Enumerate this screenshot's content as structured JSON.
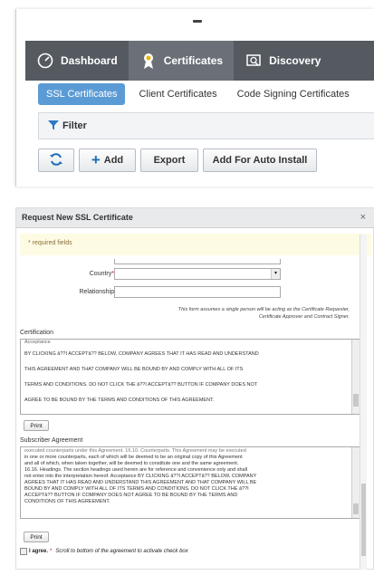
{
  "nav": {
    "tabs": [
      {
        "label": "Dashboard",
        "icon": "gauge-icon"
      },
      {
        "label": "Certificates",
        "icon": "ribbon-icon"
      },
      {
        "label": "Discovery",
        "icon": "scan-icon"
      }
    ]
  },
  "subtabs": [
    "SSL Certificates",
    "Client Certificates",
    "Code Signing Certificates"
  ],
  "filter": {
    "label": "Filter"
  },
  "actions": {
    "refresh_icon": "refresh-icon",
    "add": "Add",
    "export": "Export",
    "add_auto": "Add For Auto Install"
  },
  "dialog": {
    "title": "Request New SSL Certificate",
    "required_note": "* required fields",
    "country_label": "Country",
    "relationship_label": "Relationship",
    "form_note_1": "This form assumes a single person will be acting as the Certificate Requester,",
    "form_note_2": "Certificate Approver and Contract Signer.",
    "certification_label": "Certification",
    "cert_text_0": "Acceptance",
    "cert_text_1": "BY CLICKING â??I ACCEPTâ?? BELOW, COMPANY AGREES THAT IT HAS READ AND UNDERSTAND",
    "cert_text_2": "THIS AGREEMENT AND THAT COMPANY WILL BE BOUND BY AND COMPLY WITH ALL OF ITS",
    "cert_text_3": "TERMS AND CONDITIONS. DO NOT CLICK THE â??I ACCEPTâ?? BUTTON IF COMPANY DOES NOT",
    "cert_text_4": "AGREE TO BE BOUND BY THE TERMS AND CONDITIONS OF THIS AGREEMENT.",
    "print_label": "Print",
    "subscriber_label": "Subscriber Agreement",
    "sub_text": [
      "executed counterparts under this Agreement. 16.10. Counterparts. This Agreement may be executed",
      "in one or more counterparts, each of which will be deemed to be an original copy of this Agreement",
      "and all of which, when taken together, will be deemed to constitute one and the same agreement.",
      "16.16. Headings. The section headings used herein are for reference and convenience only and shall",
      "not enter into the interpretation hereof. Acceptance BY CLICKING â??I ACCEPTâ?? BELOW, COMPANY",
      "AGREES THAT IT HAS READ AND UNDERSTAND THIS AGREEMENT AND THAT COMPANY WILL BE",
      "BOUND BY AND COMPLY WITH ALL OF ITS TERMS AND CONDITIONS. DO NOT CLICK THE â??I",
      "ACCEPTâ?? BUTTON IF COMPANY DOES NOT AGREE TO BE BOUND BY THE TERMS AND",
      "CONDITIONS OF THIS AGREEMENT."
    ],
    "agree_label": "I agree.",
    "agree_hint": "Scroll to bottom of the agreement to activate check box"
  },
  "colors": {
    "nav_bg": "#555a61",
    "nav_active": "#6b7078",
    "accent": "#5b9bd5",
    "add_plus": "#1d6fb8",
    "notice_bg": "#fefbe4"
  }
}
